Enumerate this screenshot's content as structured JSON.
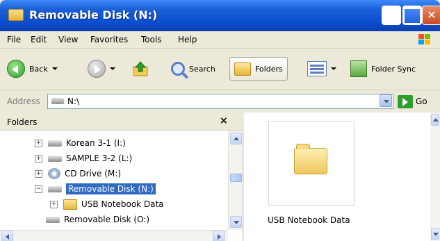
{
  "window": {
    "title": "Removable Disk (N:)",
    "controls": [
      "minimize",
      "maximize",
      "close"
    ]
  },
  "menu": {
    "items": [
      {
        "label": "File"
      },
      {
        "label": "Edit"
      },
      {
        "label": "View"
      },
      {
        "label": "Favorites"
      },
      {
        "label": "Tools"
      },
      {
        "label": "Help"
      }
    ]
  },
  "toolbar": {
    "back_label": "Back",
    "search_label": "Search",
    "folders_label": "Folders",
    "folder_sync_label": "Folder Sync"
  },
  "address": {
    "label": "Address",
    "value": "N:\\",
    "go_label": "Go"
  },
  "folders_pane": {
    "title": "Folders",
    "close_glyph": "×",
    "tree": [
      {
        "label": "Korean 3-1 (I:)",
        "expander": "+"
      },
      {
        "label": "SAMPLE 3-2 (L:)",
        "expander": "+"
      },
      {
        "label": "CD Drive (M:)",
        "expander": "+"
      },
      {
        "label": "Removable Disk (N:)",
        "expander": "−"
      },
      {
        "label": "USB Notebook Data",
        "expander": "+"
      },
      {
        "label": "Removable Disk (O:)"
      }
    ]
  },
  "content": {
    "items": [
      {
        "label": "USB Notebook Data"
      }
    ]
  }
}
